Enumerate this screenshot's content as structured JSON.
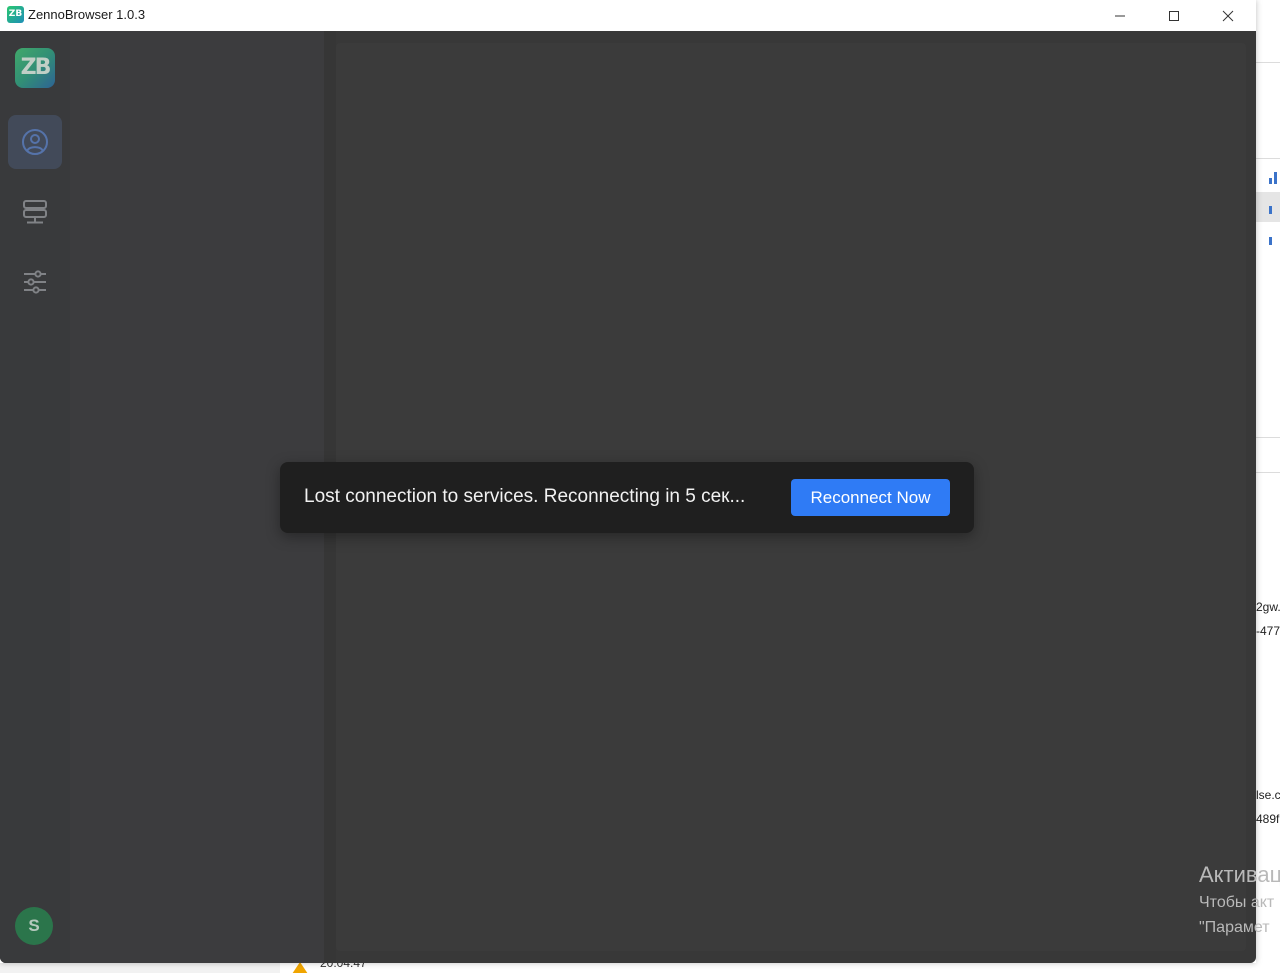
{
  "window": {
    "app_icon_text": "ZB",
    "title": "ZennoBrowser 1.0.3",
    "controls": [
      "minimize",
      "maximize",
      "close"
    ]
  },
  "rail": {
    "logo_text": "ZB",
    "items": [
      {
        "name": "profiles",
        "icon": "user-circle-icon",
        "active": true
      },
      {
        "name": "proxies",
        "icon": "server-icon",
        "active": false
      },
      {
        "name": "settings",
        "icon": "sliders-icon",
        "active": false
      }
    ],
    "avatar_letter": "S"
  },
  "toast": {
    "message": "Lost connection to services. Reconnecting in 5 сек...",
    "button_label": "Reconnect Now",
    "button_color": "#2f7bf5"
  },
  "background": {
    "right_snippets": [
      "2gw.",
      "-477",
      "lse.c",
      "489f"
    ],
    "watermark": {
      "line1": "Активац",
      "line2": "Чтобы акт",
      "line3": "\"Парамет"
    },
    "bottom_text": "20:04:47"
  }
}
